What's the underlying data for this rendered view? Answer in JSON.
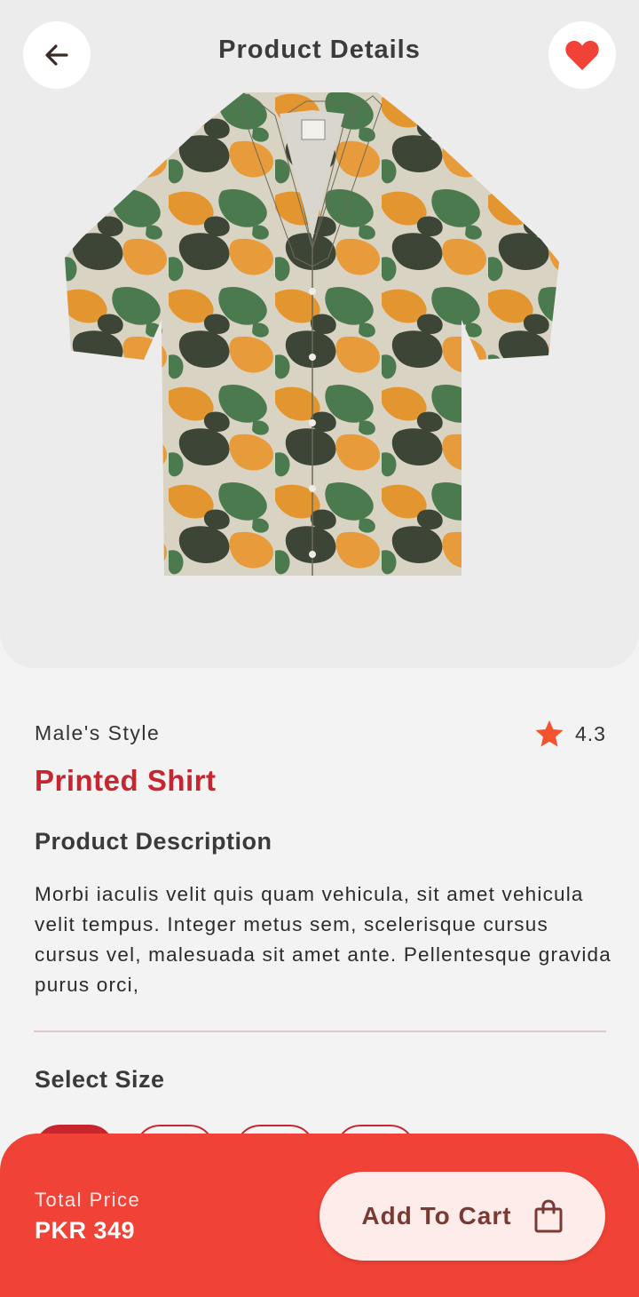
{
  "header": {
    "title": "Product Details",
    "back_icon": "arrow-left-icon",
    "favorite_icon": "heart-icon",
    "favorite_color": "#f04236"
  },
  "product": {
    "category": "Male's Style",
    "name": "Printed Shirt",
    "rating": "4.3",
    "rating_icon": "star-icon",
    "rating_color": "#f5522e",
    "image_description": "camouflage-printed-shirt"
  },
  "description": {
    "heading": "Product Description",
    "text": "Morbi iaculis velit quis quam vehicula, sit amet vehicula velit tempus. Integer metus sem, scelerisque cursus cursus vel, malesuada sit amet ante. Pellentesque gravida purus orci,"
  },
  "sizes": {
    "heading": "Select Size",
    "options": [
      "",
      "",
      "",
      ""
    ],
    "selected_index": 0
  },
  "footer": {
    "total_label": "Total Price",
    "total_value": "PKR 349",
    "cart_button_label": "Add To Cart",
    "cart_icon": "shopping-bag-icon"
  },
  "colors": {
    "accent": "#c8262e",
    "bottom_bar": "#f04236",
    "button_bg": "#fdecea"
  }
}
